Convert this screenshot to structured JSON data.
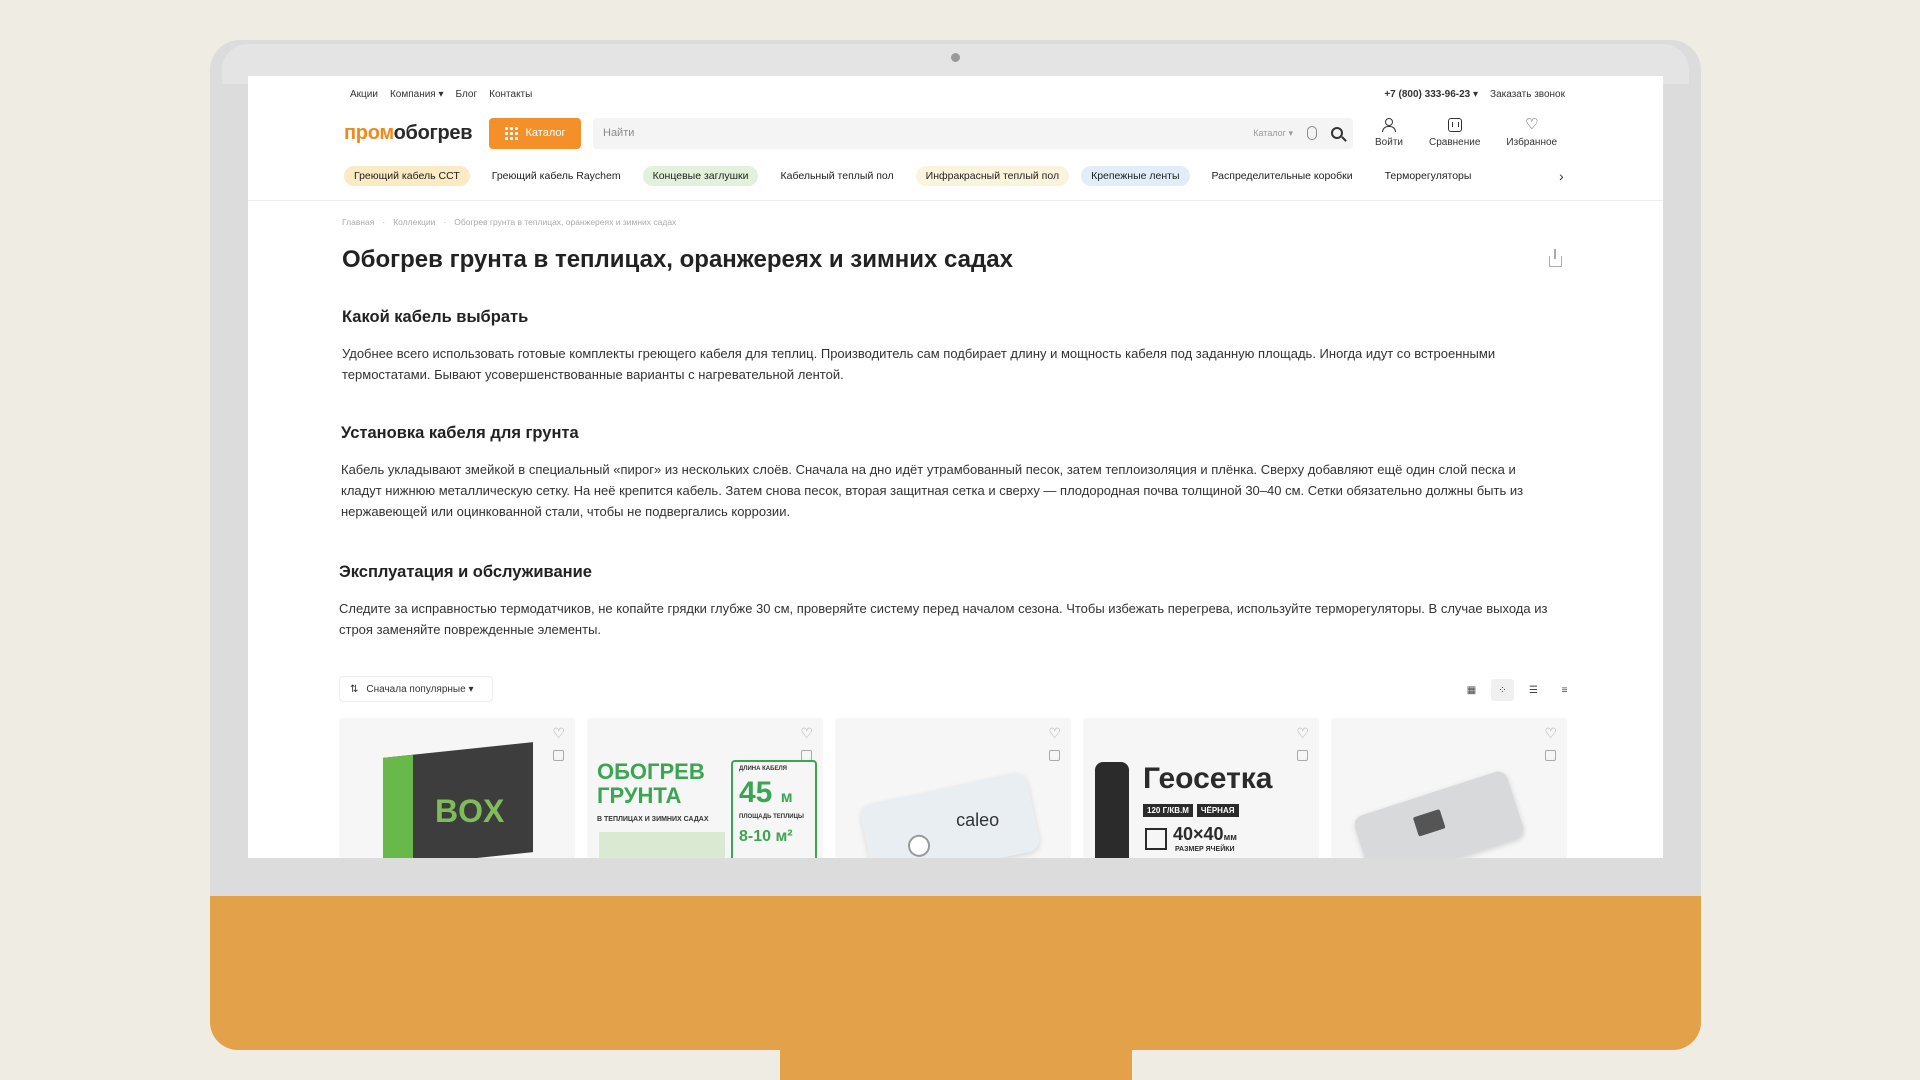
{
  "topbar": {
    "links": [
      "Акции",
      "Компания ▾",
      "Блог",
      "Контакты"
    ],
    "phone": "+7 (800) 333-96-23 ▾",
    "callback": "Заказать звонок"
  },
  "header": {
    "logo_part1": "пром",
    "logo_part2": "обогрев",
    "catalog_label": "Каталог",
    "search_placeholder": "Найти",
    "search_scope": "Каталог ▾",
    "login_label": "Войти",
    "compare_label": "Сравнение",
    "favorites_label": "Избранное"
  },
  "chips": [
    {
      "label": "Греющий кабель ССТ",
      "style": "yellow"
    },
    {
      "label": "Греющий кабель Raychem",
      "style": "plain"
    },
    {
      "label": "Концевые заглушки",
      "style": "green"
    },
    {
      "label": "Кабельный теплый пол",
      "style": "plain"
    },
    {
      "label": "Инфракрасный теплый пол",
      "style": "cream"
    },
    {
      "label": "Крепежные ленты",
      "style": "blue"
    },
    {
      "label": "Распределительные коробки",
      "style": "plain"
    },
    {
      "label": "Терморегуляторы",
      "style": "plain"
    }
  ],
  "breadcrumb": [
    "Главная",
    "·",
    "Коллекции",
    "·",
    "Обогрев грунта в теплицах, оранжереях и зимних садах"
  ],
  "page_title": "Обогрев грунта в теплицах, оранжереях и зимних садах",
  "sections": [
    {
      "title": "Какой кабель выбрать",
      "text": "Удобнее всего использовать готовые комплекты греющего кабеля для теплиц. Производитель сам подбирает длину и мощность кабеля под заданную площадь. Иногда идут со встроенными термостатами. Бывают усовершенствованные варианты с нагревательной лентой."
    },
    {
      "title": "Установка кабеля для грунта",
      "text": "Кабель укладывают змейкой в специальный «пирог» из нескольких слоёв. Сначала на дно идёт утрамбованный песок, затем теплоизоляция и плёнка. Сверху добавляют ещё один слой песка и кладут нижнюю металлическую сетку. На неё крепится кабель. Затем снова песок, вторая защитная сетка и сверху — плодородная почва толщиной 30–40 см. Сетки обязательно должны быть из нержавеющей или оцинкованной стали, чтобы не подвергались коррозии."
    },
    {
      "title": "Эксплуатация и обслуживание",
      "text": "Следите за исправностью термодатчиков, не копайте грядки глубже 30 см, проверяйте систему перед началом сезона. Чтобы избежать перегрева, используйте терморегуляторы. В случае выхода из строя заменяйте поврежденные элементы."
    }
  ],
  "sort": {
    "icon": "⇅",
    "label": "Сначала популярные ▾"
  },
  "view_icons": [
    "▦",
    "⁘",
    "☰",
    "≡"
  ],
  "products": {
    "p1": {
      "brand": "BOX"
    },
    "p2": {
      "title_line1": "ОБОГРЕВ",
      "title_line2": "ГРУНТА",
      "subtitle": "В ТЕПЛИЦАХ И ЗИМНИХ САДАХ",
      "len_label": "ДЛИНА КАБЕЛЯ",
      "len_value": "45",
      "len_unit": "м",
      "area_label": "ПЛОЩАДЬ ТЕПЛИЦЫ",
      "area_value": "8-10 м²"
    },
    "p3": {
      "brand": "caleo"
    },
    "p4": {
      "title": "Геосетка",
      "tag1": "120 Г/КВ.М",
      "tag2": "ЧЁРНАЯ",
      "size": "40×40",
      "size_unit": "мм",
      "size_label": "РАЗМЕР ЯЧЕЙКИ"
    }
  }
}
